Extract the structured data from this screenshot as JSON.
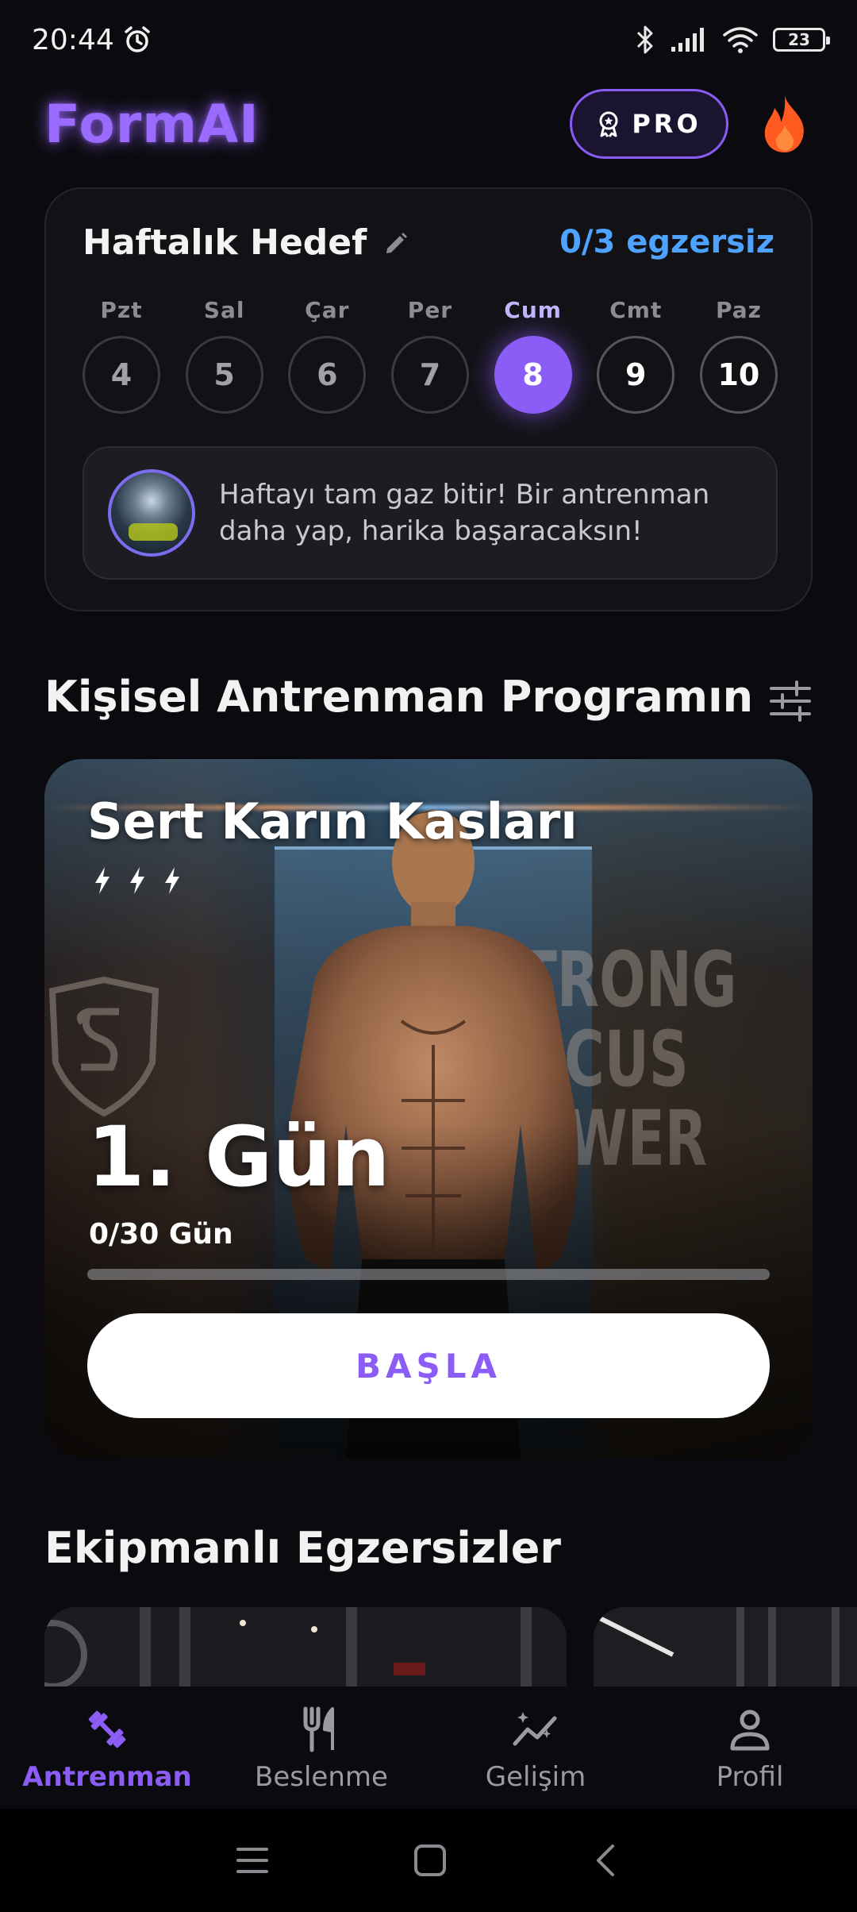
{
  "status_bar": {
    "time": "20:44",
    "battery": "23"
  },
  "header": {
    "logo": "FormAI",
    "pro_label": "PRO"
  },
  "weekly_goal": {
    "title": "Haftalık Hedef",
    "count": "0/3 egzersiz",
    "days": [
      {
        "name": "Pzt",
        "number": "4"
      },
      {
        "name": "Sal",
        "number": "5"
      },
      {
        "name": "Çar",
        "number": "6"
      },
      {
        "name": "Per",
        "number": "7"
      },
      {
        "name": "Cum",
        "number": "8"
      },
      {
        "name": "Cmt",
        "number": "9"
      },
      {
        "name": "Paz",
        "number": "10"
      }
    ],
    "active_day_index": 4,
    "motivation_text": "Haftayı tam gaz bitir! Bir antrenman daha yap, harika başaracaksın!"
  },
  "program_section": {
    "title": "Kişisel Antrenman Programın",
    "card": {
      "title": "Sert Karın Kasları",
      "intensity_bolts": 3,
      "day_label": "1. Gün",
      "progress_label": "0/30 Gün",
      "progress_fraction": 0,
      "wall_text": [
        "STRONG",
        "FOCUS",
        "POWER"
      ],
      "start_label": "BAŞLA"
    }
  },
  "equipment_section": {
    "title": "Ekipmanlı Egzersizler"
  },
  "bottom_nav": {
    "items": [
      {
        "label": "Antrenman",
        "icon": "dumbbell-icon",
        "active": true
      },
      {
        "label": "Beslenme",
        "icon": "fork-knife-icon",
        "active": false
      },
      {
        "label": "Gelişim",
        "icon": "progress-chart-icon",
        "active": false
      },
      {
        "label": "Profil",
        "icon": "person-icon",
        "active": false
      }
    ]
  },
  "colors": {
    "accent": "#8b5cf6",
    "goal_count": "#4da3ff",
    "background": "#0b0b0f",
    "flame": "#ff5a1f"
  }
}
